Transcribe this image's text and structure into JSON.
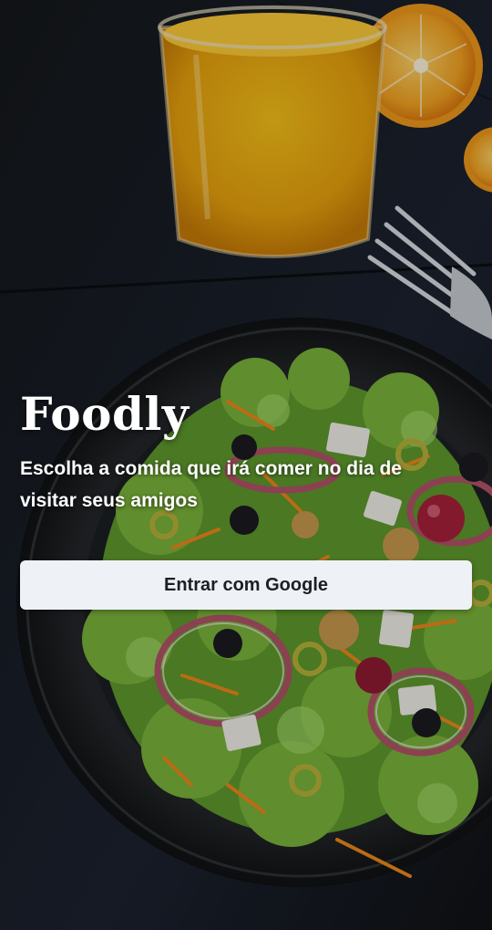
{
  "app": {
    "name": "Foodly",
    "tagline": "Escolha a comida que irá comer no dia de visitar seus amigos"
  },
  "actions": {
    "google_login_label": "Entrar com Google"
  },
  "colors": {
    "background": "#121518",
    "button_background": "#eef1f6",
    "button_text": "#1c1f24",
    "text": "#ffffff"
  }
}
